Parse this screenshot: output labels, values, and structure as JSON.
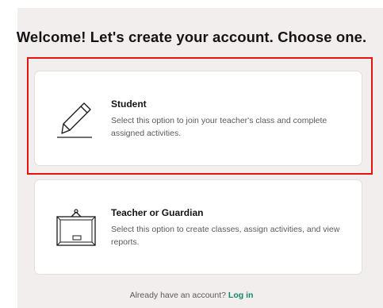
{
  "header": {
    "title": "Welcome! Let's create your account. Choose one."
  },
  "options": [
    {
      "title": "Student",
      "description": "Select this option to join your teacher's class and complete assigned activities.",
      "icon": "pencil-icon"
    },
    {
      "title": "Teacher or Guardian",
      "description": "Select this option to create classes, assign activities, and view reports.",
      "icon": "chalkboard-icon"
    }
  ],
  "footer": {
    "prompt": "Already have an account?",
    "login_label": "Log in"
  },
  "colors": {
    "background": "#f2eeee",
    "card": "#ffffff",
    "link": "#14866d",
    "highlight": "#e8130e"
  }
}
